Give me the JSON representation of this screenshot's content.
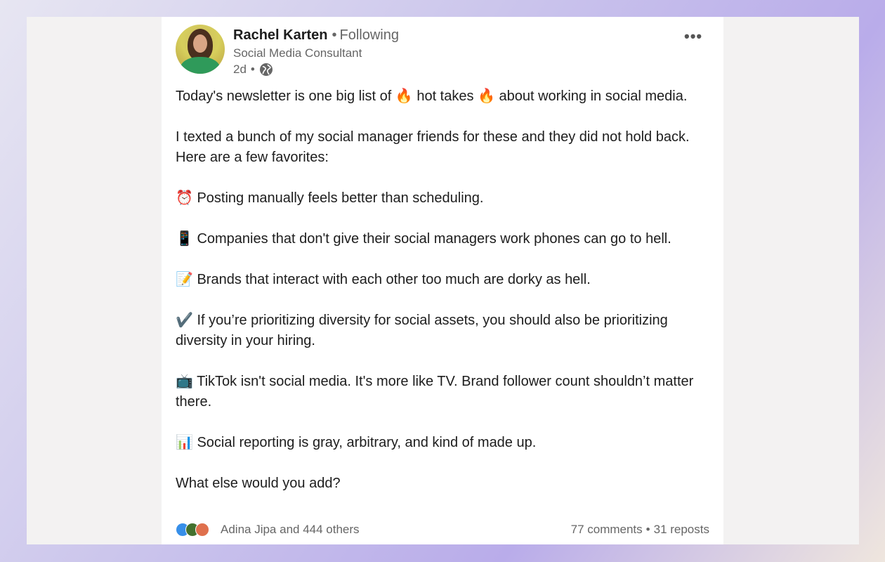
{
  "author": {
    "name": "Rachel Karten",
    "follow_status": "Following",
    "headline": "Social Media Consultant",
    "time": "2d"
  },
  "post": {
    "paragraphs": [
      "Today's newsletter is one big list of 🔥 hot takes 🔥 about working in social media.",
      "I texted a bunch of my social manager friends for these and they did not hold back. Here are a few favorites:",
      "⏰ Posting manually feels better than scheduling.",
      "📱 Companies that don't give their social managers work phones can go to hell.",
      "📝 Brands that interact with each other too much are dorky as hell.",
      "✔️ If you’re prioritizing diversity for social assets, you should also be prioritizing diversity in your hiring.",
      "📺 TikTok isn't social media. It's more like TV. Brand follower count shouldn’t matter there.",
      "📊 Social reporting is gray, arbitrary, and kind of made up.",
      "What else would you add?"
    ]
  },
  "social": {
    "reactions_text": "Adina Jipa and 444 others",
    "comments": "77 comments",
    "reposts": "31 reposts",
    "reaction_icons": [
      "like-icon",
      "celebrate-icon",
      "love-icon"
    ]
  },
  "icons": {
    "more": "more-options-icon",
    "visibility": "globe-icon"
  },
  "colors": {
    "like": "#378fe9",
    "celebrate": "#44712e",
    "love": "#df704d"
  }
}
